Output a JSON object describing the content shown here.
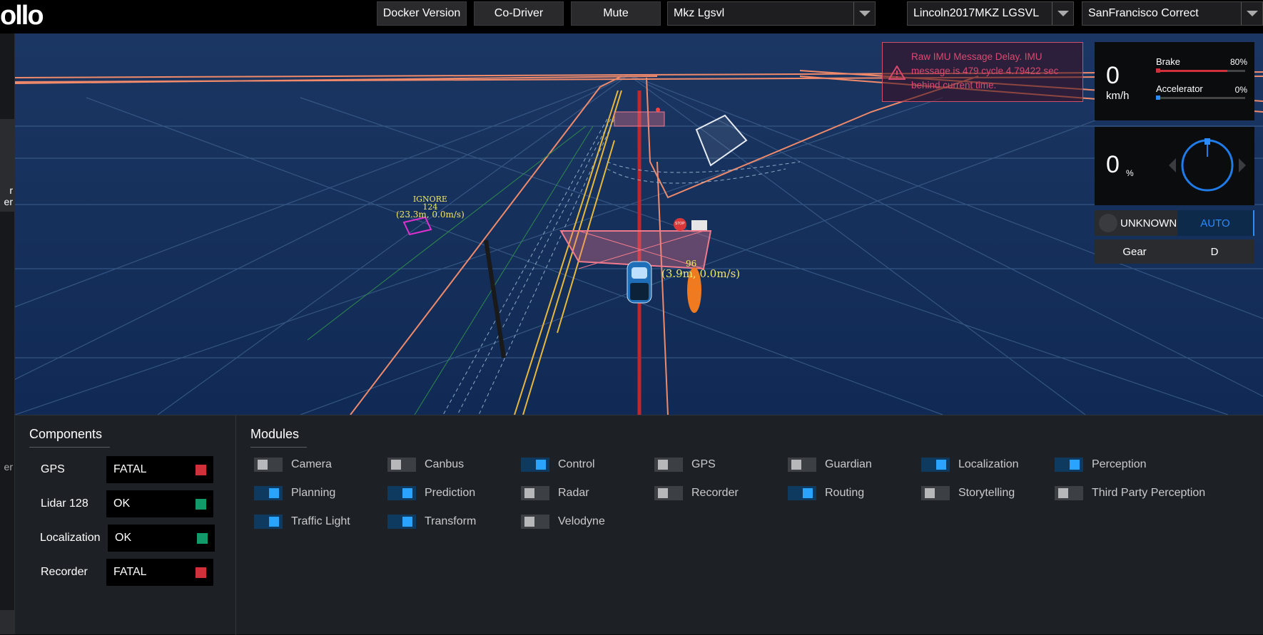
{
  "header": {
    "logo": "ollo",
    "buttons": {
      "docker": "Docker Version",
      "codriver": "Co-Driver",
      "mute": "Mute"
    },
    "selects": {
      "mode": "Mkz Lgsvl",
      "vehicle": "Lincoln2017MKZ LGSVL",
      "map": "SanFrancisco Correct"
    }
  },
  "left_strip": {
    "tab_a_frag_1": "r",
    "tab_a_frag_2": "er",
    "tab_b_frag": "er"
  },
  "scene": {
    "obstacle_ignore": {
      "status": "IGNORE",
      "id": "124",
      "info": "(23.3m, 0.0m/s)"
    },
    "obstacle_near": {
      "id": "96",
      "info": "(3.9m, 0.0m/s)"
    },
    "sign": "STOP"
  },
  "alert": {
    "message": "Raw IMU Message Delay. IMU message is 479 cycle 4.79422 sec behind current time."
  },
  "dashboard": {
    "speed": "0",
    "speed_unit": "km/h",
    "brake_label": "Brake",
    "brake_pct": "80%",
    "accelerator_label": "Accelerator",
    "accelerator_pct": "0%",
    "steering": "0",
    "steering_unit": "%",
    "driving_mode": "UNKNOWN",
    "auto_label": "AUTO",
    "gear_label": "Gear",
    "gear_value": "D"
  },
  "components": {
    "title": "Components",
    "items": [
      {
        "label": "GPS",
        "status": "FATAL",
        "color": "#d0303a"
      },
      {
        "label": "Lidar 128",
        "status": "OK",
        "color": "#119a6a"
      },
      {
        "label": "Localization",
        "status": "OK",
        "color": "#119a6a"
      },
      {
        "label": "Recorder",
        "status": "FATAL",
        "color": "#d0303a"
      }
    ]
  },
  "modules": {
    "title": "Modules",
    "items": [
      {
        "label": "Camera",
        "on": false
      },
      {
        "label": "Canbus",
        "on": false
      },
      {
        "label": "Control",
        "on": true
      },
      {
        "label": "GPS",
        "on": false
      },
      {
        "label": "Guardian",
        "on": false
      },
      {
        "label": "Localization",
        "on": true
      },
      {
        "label": "Perception",
        "on": true
      },
      {
        "label": "Planning",
        "on": true
      },
      {
        "label": "Prediction",
        "on": true
      },
      {
        "label": "Radar",
        "on": false
      },
      {
        "label": "Recorder",
        "on": false
      },
      {
        "label": "Routing",
        "on": true
      },
      {
        "label": "Storytelling",
        "on": false
      },
      {
        "label": "Third Party Perception",
        "on": false
      },
      {
        "label": "Traffic Light",
        "on": true
      },
      {
        "label": "Transform",
        "on": true
      },
      {
        "label": "Velodyne",
        "on": false
      }
    ]
  },
  "colors": {
    "accent": "#2aa3ff",
    "fatal": "#d0303a",
    "ok": "#119a6a",
    "alert": "#d94a70"
  }
}
